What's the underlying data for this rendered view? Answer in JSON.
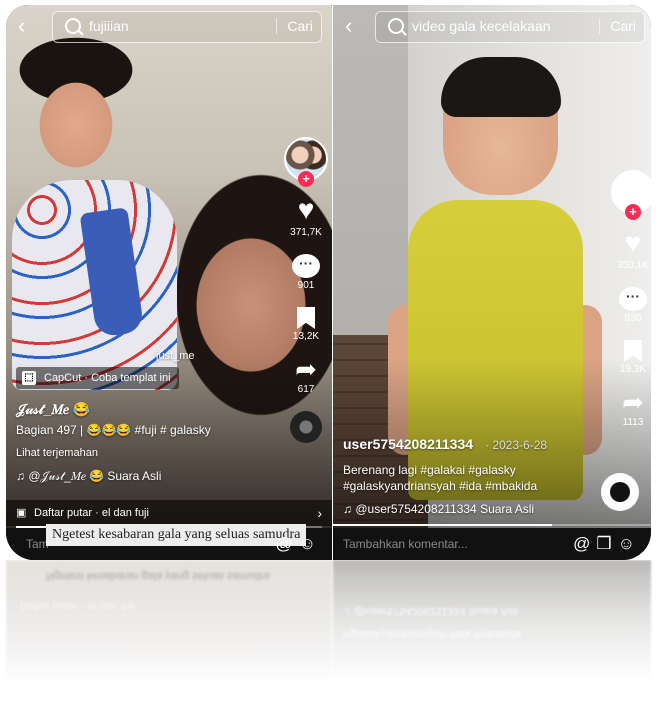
{
  "left": {
    "search_query": "fujiiian",
    "search_button": "Cari",
    "likes": "371,7K",
    "comments": "901",
    "saves": "13,2K",
    "shares": "617",
    "tag_name": "just_me",
    "capcut_label": "CapCut · Coba templat ini",
    "author": "𝒥𝓊𝓈𝓉_𝑀𝑒 😂",
    "caption": "Bagian 497 | 😂😂😂 #fuji # galasky",
    "translate": "Lihat terjemahan",
    "sound": "♫ @𝒥𝓊𝓈𝓉_𝑀𝑒 😂 Suara Asli",
    "playlist": "Daftar putar · el dan fuji",
    "comment_placeholder": "Tam",
    "overlay_comment": "Ngetest kesabaran gala yang seluas samudra",
    "progress": 0.26
  },
  "right": {
    "search_query": "video gala kecelakaan",
    "search_button": "Cari",
    "likes": "350,1K",
    "comments": "930",
    "saves": "19,3K",
    "shares": "1113",
    "author": "user5754208211334",
    "date": "· 2023-6-28",
    "caption_line1": "Berenang lagi #galakai #galasky",
    "caption_line2": "#galaskyandriansyah #ida #mbakida",
    "sound": "♫ @user5754208211334 Suara Asli",
    "comment_placeholder": "Tambahkan komentar...",
    "progress": 0.69
  },
  "icons": {
    "back": "chevron-left",
    "search": "magnifier",
    "like": "heart",
    "comment": "speech-bubble",
    "save": "bookmark",
    "share": "arrow",
    "mention": "at-sign",
    "gift": "gift",
    "emoji": "smiley"
  },
  "colors": {
    "accent_red": "#fe2c55",
    "overlay_bg": "#ededed"
  }
}
